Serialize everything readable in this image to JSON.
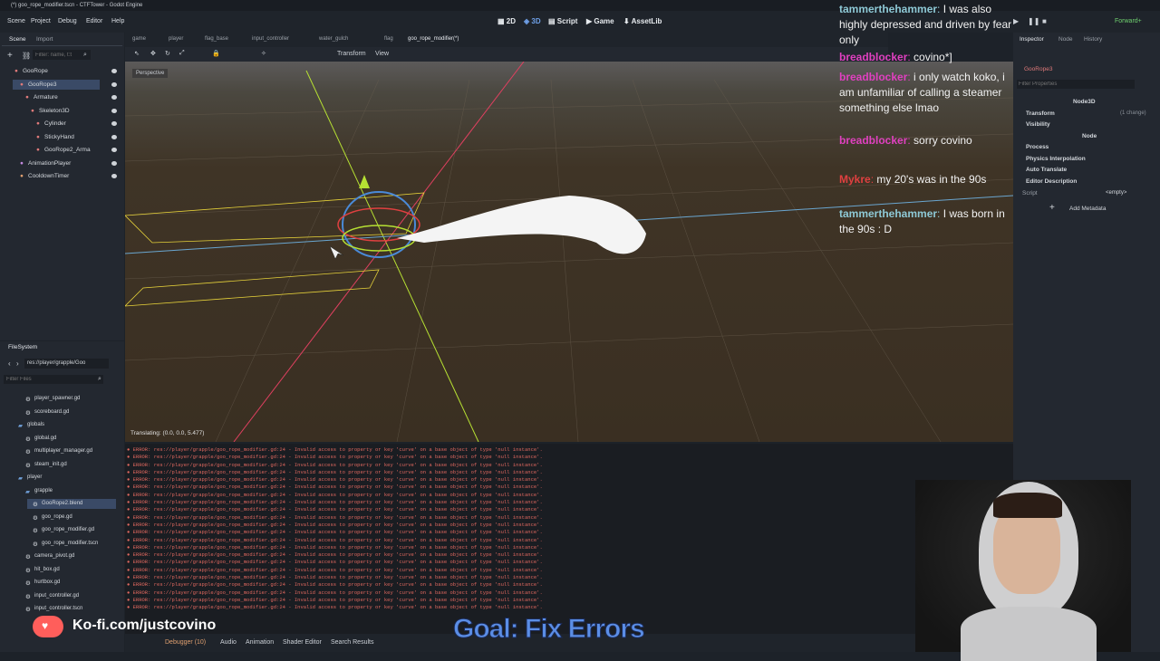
{
  "window": {
    "title": "(*) goo_rope_modifier.tscn - CTFTower - Godot Engine"
  },
  "menu": [
    "Scene",
    "Project",
    "Debug",
    "Editor",
    "Help"
  ],
  "workspaces": [
    "2D",
    "3D",
    "Script",
    "Game",
    "AssetLib"
  ],
  "renderer": "Forward+",
  "scene_dock": {
    "tabs": [
      "Scene",
      "Import"
    ],
    "filter_placeholder": "Filter: name, t:t",
    "tree": [
      {
        "label": "GooRope",
        "depth": 0,
        "color": "#e07a7a"
      },
      {
        "label": "GooRope3",
        "depth": 1,
        "color": "#e07a7a",
        "selected": true
      },
      {
        "label": "Armature",
        "depth": 2,
        "color": "#e07a7a"
      },
      {
        "label": "Skeleton3D",
        "depth": 3,
        "color": "#e07a7a"
      },
      {
        "label": "Cylinder",
        "depth": 4,
        "color": "#e07a7a"
      },
      {
        "label": "StickyHand",
        "depth": 4,
        "color": "#e07a7a"
      },
      {
        "label": "GooRope2_Arma",
        "depth": 4,
        "color": "#e07a7a"
      },
      {
        "label": "AnimationPlayer",
        "depth": 1,
        "color": "#c58ae0"
      },
      {
        "label": "CooldownTimer",
        "depth": 1,
        "color": "#e0a070"
      }
    ]
  },
  "filesystem": {
    "title": "FileSystem",
    "path": "res://player/grapple/Goo",
    "filter_placeholder": "Filter Files",
    "items": [
      {
        "label": "player_spawner.gd",
        "depth": 1
      },
      {
        "label": "scoreboard.gd",
        "depth": 1
      },
      {
        "label": "globals",
        "depth": 0,
        "folder": true
      },
      {
        "label": "global.gd",
        "depth": 1
      },
      {
        "label": "multiplayer_manager.gd",
        "depth": 1
      },
      {
        "label": "steam_init.gd",
        "depth": 1
      },
      {
        "label": "player",
        "depth": 0,
        "folder": true
      },
      {
        "label": "grapple",
        "depth": 1,
        "folder": true
      },
      {
        "label": "GooRope2.blend",
        "depth": 2,
        "selected": true
      },
      {
        "label": "goo_rope.gd",
        "depth": 2
      },
      {
        "label": "goo_rope_modifier.gd",
        "depth": 2
      },
      {
        "label": "goo_rope_modifier.tscn",
        "depth": 2
      },
      {
        "label": "camera_pivot.gd",
        "depth": 1
      },
      {
        "label": "hit_box.gd",
        "depth": 1
      },
      {
        "label": "hurtbox.gd",
        "depth": 1
      },
      {
        "label": "input_controller.gd",
        "depth": 1
      },
      {
        "label": "input_controller.tscn",
        "depth": 1
      }
    ]
  },
  "editor_tabs": [
    "game",
    "player",
    "flag_base",
    "input_controller",
    "water_gulch",
    "flag",
    "goo_rope_modifier(*)"
  ],
  "viewport": {
    "toolbar_labels": [
      "Transform",
      "View"
    ],
    "perspective": "Perspective",
    "status": "Translating: (0.0, 0.0, 5.477)"
  },
  "errors": {
    "line": "ERROR: res://player/grapple/goo_rope_modifier.gd:24 - Invalid access to property or key 'curve' on a base object of type 'null instance'.",
    "count": 22
  },
  "bottom_tabs": [
    "Debugger (10)",
    "Audio",
    "Animation",
    "Shader Editor",
    "Search Results"
  ],
  "inspector": {
    "tabs": [
      "Inspector",
      "Node",
      "History"
    ],
    "node_name": "GooRope3",
    "filter_placeholder": "Filter Properties",
    "class": "Node3D",
    "transform": "Transform",
    "changes": "(1 change)",
    "visibility": "Visibility",
    "node_section": "Node",
    "sections": [
      "Process",
      "Physics Interpolation",
      "Auto Translate",
      "Editor Description"
    ],
    "script_label": "Script",
    "script_value": "<empty>",
    "add_metadata": "Add Metadata"
  },
  "chat": [
    {
      "user": "tammerthehammer",
      "color": "#8ec9d6",
      "text": "I was also highly depressed and driven by fear only"
    },
    {
      "user": "breadblocker",
      "color": "#e040c0",
      "text": "covino*]"
    },
    {
      "user": "breadblocker",
      "color": "#e040c0",
      "text": "i only watch koko, i am unfamiliar of calling a steamer something else lmao"
    },
    {
      "user": "breadblocker",
      "color": "#e040c0",
      "text": "sorry covino"
    },
    {
      "user": "Mykre",
      "color": "#e04040",
      "text": "my 20's was in the 90s"
    },
    {
      "user": "tammerthehammer",
      "color": "#8ec9d6",
      "text": "I was born in the 90s : D"
    }
  ],
  "overlay": {
    "kofi": "Ko-fi.com/justcovino",
    "goal": "Goal: Fix Errors"
  },
  "colors": {
    "accent": "#5b8ee6",
    "error": "#e0685f",
    "selection": "#3a4a66"
  }
}
